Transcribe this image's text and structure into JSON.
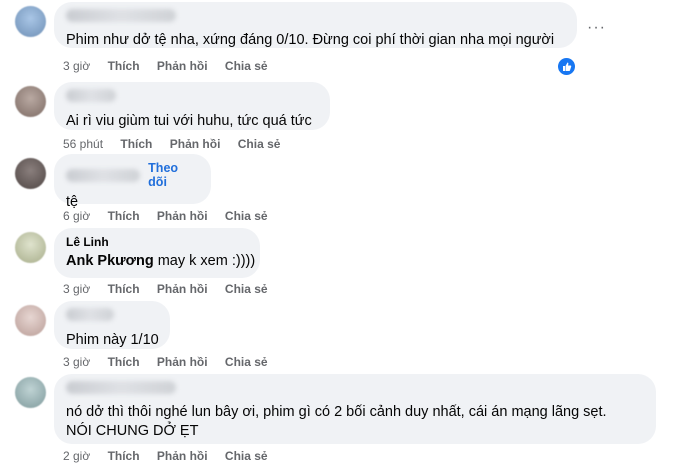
{
  "comments": [
    {
      "text": "Phim như dở tệ nha, xứng đáng 0/10. Đừng coi phí thời gian nha mọi người",
      "time": "3 giờ",
      "like": "Thích",
      "reply": "Phản hồi",
      "share": "Chia sẻ",
      "more_icon": "···"
    },
    {
      "text": "Ai rì viu giùm tui với huhu, tức quá tức",
      "time": "56 phút",
      "like": "Thích",
      "reply": "Phản hồi",
      "share": "Chia sẻ"
    },
    {
      "follow": "Theo dõi",
      "text": "tệ",
      "time": "6 giờ",
      "like": "Thích",
      "reply": "Phản hồi",
      "share": "Chia sẻ"
    },
    {
      "name": "Lê Linh",
      "mention": "Ank Pkương",
      "text": " may k xem :))))",
      "time": "3 giờ",
      "like": "Thích",
      "reply": "Phản hồi",
      "share": "Chia sẻ"
    },
    {
      "text": "Phim này 1/10",
      "time": "3 giờ",
      "like": "Thích",
      "reply": "Phản hồi",
      "share": "Chia sẻ"
    },
    {
      "text": "nó dở thì thôi nghé lun bây ơi, phim gì có 2 bối cảnh duy nhất, cái án mạng lãng sẹt. NÓI CHUNG DỞ ẸT",
      "time": "2 giờ",
      "like": "Thích",
      "reply": "Phản hồi",
      "share": "Chia sẻ"
    }
  ],
  "colors": {
    "bubble": "#f0f2f5",
    "meta": "#65676b",
    "link": "#216fdb",
    "like": "#1877f2"
  },
  "icons": {
    "like_badge": "thumbs-up-icon",
    "more": "more-horizontal-icon"
  }
}
